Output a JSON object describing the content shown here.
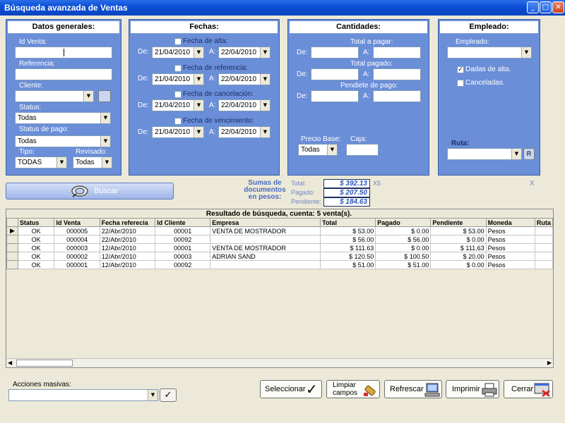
{
  "window": {
    "title": "Búsqueda avanzada de Ventas"
  },
  "general": {
    "header": "Datos generales:",
    "id_venta_label": "Id Venta:",
    "referencia_label": "Referencia:",
    "cliente_label": "Cliente:",
    "status_label": "Status:",
    "status_value": "Todas",
    "status_pago_label": "Status de pago:",
    "status_pago_value": "Todas",
    "tipo_label": "Tipo:",
    "tipo_value": "TODAS",
    "revisado_label": "Revisado:",
    "revisado_value": "Todas"
  },
  "fechas": {
    "header": "Fechas:",
    "de_label": "De:",
    "a_label": "A:",
    "rows": [
      {
        "label": "Fecha de alta:",
        "from": "21/04/2010",
        "to": "22/04/2010"
      },
      {
        "label": "Fecha de referencia:",
        "from": "21/04/2010",
        "to": "22/04/2010"
      },
      {
        "label": "Fecha de cancelación:",
        "from": "21/04/2010",
        "to": "22/04/2010"
      },
      {
        "label": "Fecha de vencimiento:",
        "from": "21/04/2010",
        "to": "22/04/2010"
      }
    ]
  },
  "cantidades": {
    "header": "Cantidades:",
    "de_label": "De:",
    "a_label": "A:",
    "total_pagar_label": "Total a pagar:",
    "total_pagado_label": "Total pagado:",
    "pendiente_label": "Pendiete de pago:",
    "precio_base_label": "Precio Base:",
    "precio_base_value": "Todas",
    "caja_label": "Caja:"
  },
  "empleado": {
    "header": "Empleado:",
    "empleado_label": "Empleado:",
    "alta_label": "Dadas de alta.",
    "canceladas_label": "Canceladas.",
    "ruta_label": "Ruta:",
    "ruta_btn": "R"
  },
  "buscar": {
    "label": "Buscar"
  },
  "sumas": {
    "title": "Sumas de documentos en pesos:",
    "total_label": "Total:",
    "total_value": "$ 392.13",
    "pagado_label": "Pagado:",
    "pagado_value": "$ 207.50",
    "pendiente_label": "Pendiente:",
    "pendiente_value": "$ 184.63",
    "x5": "X5",
    "x": "X"
  },
  "grid": {
    "title": "Resultado de búsqueda, cuenta: 5 venta(s).",
    "columns": [
      "Status",
      "Id Venta",
      "Fecha referecia",
      "Id Cliente",
      "Empresa",
      "Total",
      "Pagado",
      "Pendiente",
      "Moneda",
      "Ruta"
    ],
    "rows": [
      {
        "status": "OK",
        "id": "000005",
        "fecha": "22/Abr/2010",
        "cliente": "00001",
        "empresa": "VENTA DE MOSTRADOR",
        "total": "$ 53.00",
        "pagado": "$ 0.00",
        "pendiente": "$ 53.00",
        "moneda": "Pesos"
      },
      {
        "status": "OK",
        "id": "000004",
        "fecha": "22/Abr/2010",
        "cliente": "00092",
        "empresa": "",
        "total": "$ 56.00",
        "pagado": "$ 56.00",
        "pendiente": "$ 0.00",
        "moneda": "Pesos"
      },
      {
        "status": "OK",
        "id": "000003",
        "fecha": "12/Abr/2010",
        "cliente": "00001",
        "empresa": "VENTA DE MOSTRADOR",
        "total": "$ 111.63",
        "pagado": "$ 0.00",
        "pendiente": "$ 111.63",
        "moneda": "Pesos"
      },
      {
        "status": "OK",
        "id": "000002",
        "fecha": "12/Abr/2010",
        "cliente": "00003",
        "empresa": "ADRIAN SAND",
        "total": "$ 120.50",
        "pagado": "$ 100.50",
        "pendiente": "$ 20.00",
        "moneda": "Pesos"
      },
      {
        "status": "OK",
        "id": "000001",
        "fecha": "12/Abr/2010",
        "cliente": "00092",
        "empresa": "",
        "total": "$ 51.00",
        "pagado": "$ 51.00",
        "pendiente": "$ 0.00",
        "moneda": "Pesos"
      }
    ]
  },
  "acciones": {
    "label": "Acciones masivas:"
  },
  "buttons": {
    "seleccionar": "Seleccionar",
    "limpiar_1": "Limpiar",
    "limpiar_2": "campos",
    "refrescar": "Refrescar",
    "imprimir": "Imprimir",
    "cerrar": "Cerrar"
  }
}
